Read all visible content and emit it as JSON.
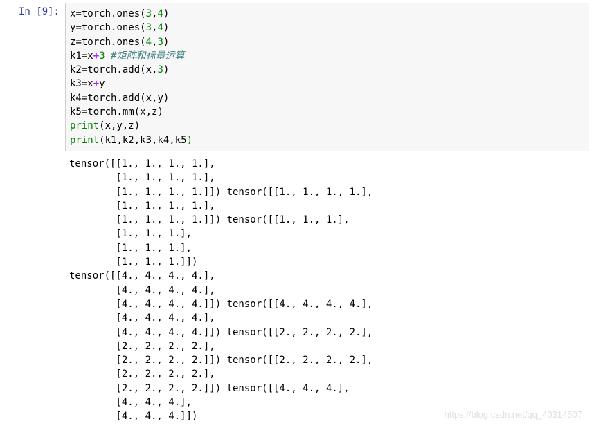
{
  "prompt": "In [9]:",
  "code": {
    "l1": {
      "a": "x",
      "eq": "=",
      "b": "torch.ones",
      "lp": "(",
      "n1": "3",
      "c": ",",
      "n2": "4",
      "rp": ")"
    },
    "l2": {
      "a": "y",
      "eq": "=",
      "b": "torch.ones",
      "lp": "(",
      "n1": "3",
      "c": ",",
      "n2": "4",
      "rp": ")"
    },
    "l3": {
      "a": "z",
      "eq": "=",
      "b": "torch.ones",
      "lp": "(",
      "n1": "4",
      "c": ",",
      "n2": "3",
      "rp": ")"
    },
    "l4": {
      "a": "k1",
      "eq": "=",
      "b": "x",
      "plus": "+",
      "n": "3",
      "sp": " ",
      "comment": "#矩阵和标量运算"
    },
    "l5": {
      "a": "k2",
      "eq": "=",
      "b": "torch.add",
      "lp": "(",
      "arg1": "x",
      "c": ",",
      "n": "3",
      "rp": ")"
    },
    "l6": {
      "a": "k3",
      "eq": "=",
      "b": "x",
      "plus": "+",
      "c": "y"
    },
    "l7": {
      "a": "k4",
      "eq": "=",
      "b": "torch.add",
      "lp": "(",
      "arg1": "x",
      "c": ",",
      "arg2": "y",
      "rp": ")"
    },
    "l8": {
      "a": "k5",
      "eq": "=",
      "b": "torch.mm",
      "lp": "(",
      "arg1": "x",
      "c": ",",
      "arg2": "z",
      "rp": ")"
    },
    "l9": {
      "fn": "print",
      "lp": "(",
      "args": "x,y,z",
      "rp": ")"
    },
    "l10": {
      "fn": "print",
      "lp": "(",
      "args": "k1,k2,k3,k4,k5",
      "rp": ")"
    }
  },
  "output": "tensor([[1., 1., 1., 1.],\n        [1., 1., 1., 1.],\n        [1., 1., 1., 1.]]) tensor([[1., 1., 1., 1.],\n        [1., 1., 1., 1.],\n        [1., 1., 1., 1.]]) tensor([[1., 1., 1.],\n        [1., 1., 1.],\n        [1., 1., 1.],\n        [1., 1., 1.]])\ntensor([[4., 4., 4., 4.],\n        [4., 4., 4., 4.],\n        [4., 4., 4., 4.]]) tensor([[4., 4., 4., 4.],\n        [4., 4., 4., 4.],\n        [4., 4., 4., 4.]]) tensor([[2., 2., 2., 2.],\n        [2., 2., 2., 2.],\n        [2., 2., 2., 2.]]) tensor([[2., 2., 2., 2.],\n        [2., 2., 2., 2.],\n        [2., 2., 2., 2.]]) tensor([[4., 4., 4.],\n        [4., 4., 4.],\n        [4., 4., 4.]])",
  "watermark": "https://blog.csdn.net/qq_40314507"
}
